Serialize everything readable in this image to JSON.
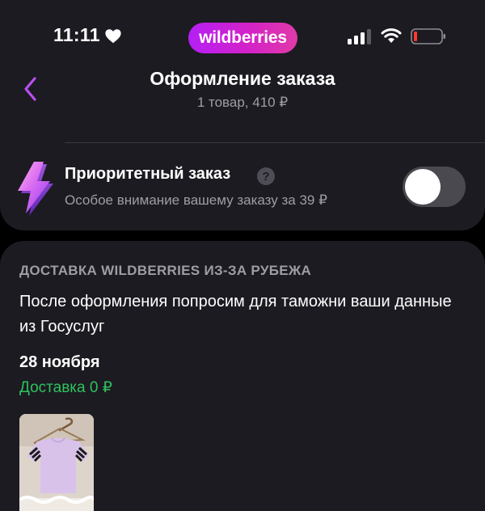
{
  "status_bar": {
    "time": "11:11",
    "brand": "wildberries",
    "icons": [
      "heart-icon",
      "signal-icon",
      "wifi-icon",
      "battery-icon"
    ]
  },
  "header": {
    "title": "Оформление заказа",
    "subtitle": "1 товар, 410 ₽"
  },
  "priority": {
    "title": "Приоритетный заказ",
    "help_glyph": "?",
    "description": "Особое внимание вашему заказу за 39 ₽",
    "enabled": false
  },
  "delivery": {
    "heading": "ДОСТАВКА WILDBERRIES ИЗ-ЗА РУБЕЖА",
    "note": "После оформления попросим для таможни ваши данные из Госуслуг",
    "date": "28 ноября",
    "cost": "Доставка 0 ₽"
  },
  "colors": {
    "background": "#000000",
    "card": "#1c1b21",
    "accent_purple": "#b84ff0",
    "brand_gradient_start": "#b51ff5",
    "brand_gradient_end": "#e13aa8",
    "secondary_text": "#9e9da6",
    "success_green": "#2ec15e",
    "toggle_off": "#4a4950"
  }
}
